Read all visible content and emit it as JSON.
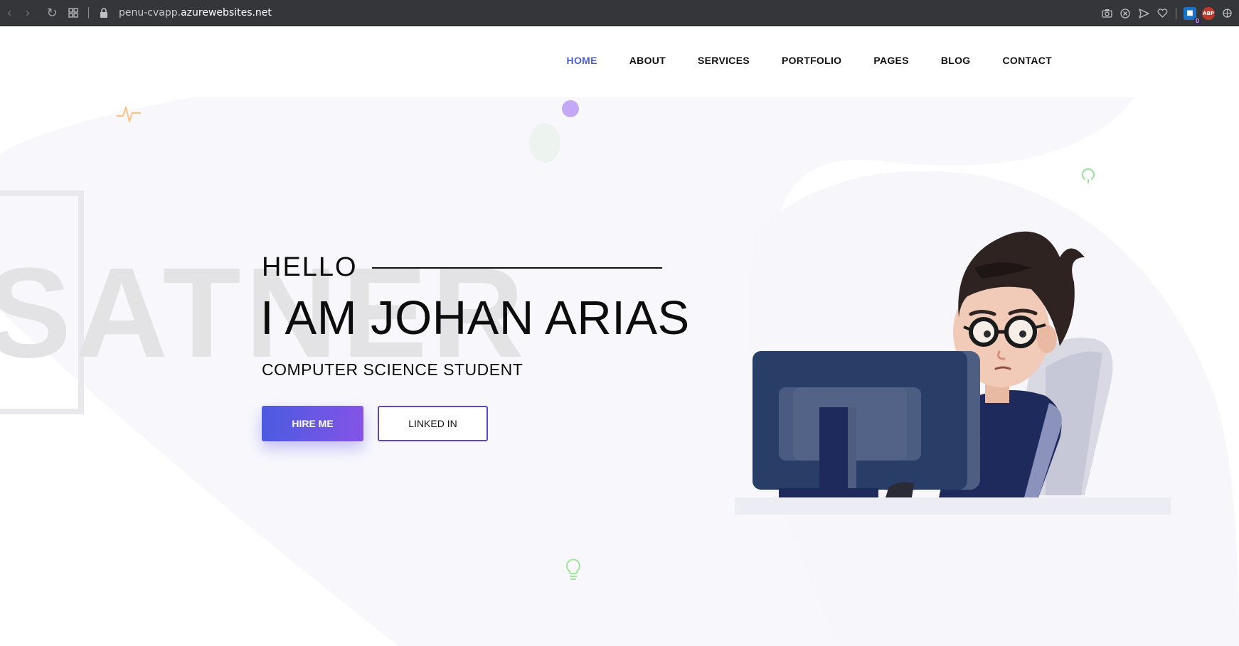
{
  "browser": {
    "url_prefix": "penu-cvapp.",
    "url_domain": "azurewebsites.net",
    "icons": [
      "back-icon",
      "forward-icon",
      "reload-icon",
      "tabs-grid-icon",
      "lock-icon",
      "camera-icon",
      "close-circle-icon",
      "send-icon",
      "heart-icon",
      "bitwarden-icon",
      "adblock-icon",
      "extensions-icon"
    ],
    "bitwarden_badge": "0",
    "abp_label": "ABP"
  },
  "nav": {
    "items": [
      {
        "label": "HOME",
        "active": true
      },
      {
        "label": "ABOUT",
        "active": false
      },
      {
        "label": "SERVICES",
        "active": false
      },
      {
        "label": "PORTFOLIO",
        "active": false
      },
      {
        "label": "PAGES",
        "active": false
      },
      {
        "label": "BLOG",
        "active": false
      },
      {
        "label": "CONTACT",
        "active": false
      }
    ]
  },
  "hero": {
    "watermark": "SATNER",
    "hello": "HELLO",
    "name": "I AM JOHAN ARIAS",
    "subtitle": "COMPUTER SCIENCE STUDENT",
    "primary_button": "HIRE ME",
    "secondary_button": "LINKED IN"
  },
  "colors": {
    "nav_active": "#4c5ed6",
    "button_gradient_start": "#4b5be0",
    "button_gradient_end": "#8454e6",
    "outline_border": "#5a48c9",
    "monitor": "#283e67",
    "shirt": "#1f2a5c",
    "hair": "#2f2321"
  }
}
